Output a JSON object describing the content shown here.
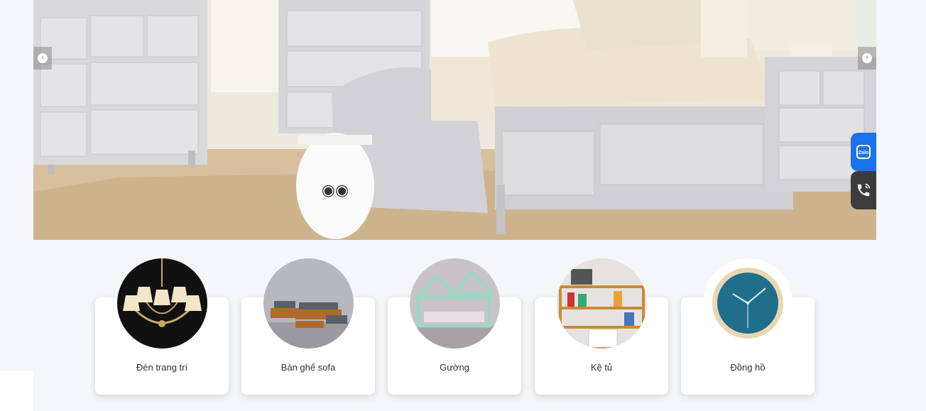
{
  "banner": {
    "prev_icon": "chevron-left-icon",
    "next_icon": "chevron-right-icon",
    "prev_glyph": "‹",
    "next_glyph": "›"
  },
  "contact": {
    "zalo_text": "Zalo",
    "zalo_icon": "zalo-icon",
    "phone_icon": "phone-icon",
    "zalo_color": "#1a73e8",
    "phone_color": "#3c3c3c"
  },
  "categories": [
    {
      "label": "Đèn trang trí"
    },
    {
      "label": "Bàn ghế sofa"
    },
    {
      "label": "Gường"
    },
    {
      "label": "Kệ tủ"
    },
    {
      "label": "Đồng hồ"
    }
  ]
}
